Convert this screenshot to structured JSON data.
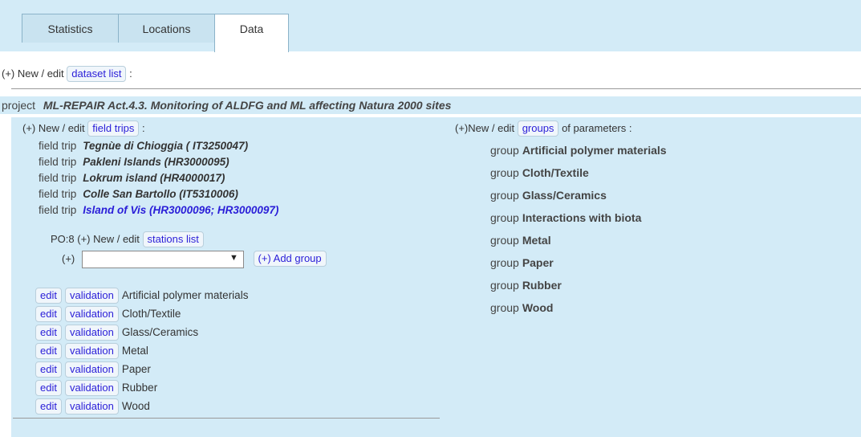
{
  "tabs": [
    {
      "label": "Statistics"
    },
    {
      "label": "Locations"
    },
    {
      "label": "Data"
    }
  ],
  "datasets": {
    "prefix": "(+) New / edit",
    "button": "dataset list",
    "suffix": ":"
  },
  "project": {
    "label": "project",
    "name": "ML-REPAIR Act.4.3. Monitoring of ALDFG and ML affecting Natura 2000 sites"
  },
  "field_trips": {
    "prefix": "(+) New / edit",
    "button": "field trips",
    "suffix": ":",
    "item_label": "field trip",
    "items": [
      {
        "name": "Tegnùe di Chioggia ( IT3250047)"
      },
      {
        "name": "Pakleni Islands (HR3000095)"
      },
      {
        "name": "Lokrum island (HR4000017)"
      },
      {
        "name": "Colle San Bartollo (IT5310006)"
      },
      {
        "name": "Island of Vis (HR3000096; HR3000097)"
      }
    ]
  },
  "stations": {
    "prefix": "PO:8 (+) New / edit",
    "button": "stations list"
  },
  "add_group": {
    "prefix": "(+)",
    "selected": "",
    "button": "(+) Add group"
  },
  "group_rows": {
    "edit_label": "edit",
    "validation_label": "validation",
    "items": [
      {
        "name": "Artificial polymer materials"
      },
      {
        "name": "Cloth/Textile"
      },
      {
        "name": "Glass/Ceramics"
      },
      {
        "name": "Metal"
      },
      {
        "name": "Paper"
      },
      {
        "name": "Rubber"
      },
      {
        "name": "Wood"
      }
    ]
  },
  "groups": {
    "prefix": "(+)New / edit",
    "button": "groups",
    "suffix": "of parameters :",
    "item_label": "group",
    "items": [
      {
        "name": "Artificial polymer materials"
      },
      {
        "name": "Cloth/Textile"
      },
      {
        "name": "Glass/Ceramics"
      },
      {
        "name": "Interactions with biota"
      },
      {
        "name": "Metal"
      },
      {
        "name": "Paper"
      },
      {
        "name": "Rubber"
      },
      {
        "name": "Wood"
      }
    ]
  },
  "colors": {
    "panel": "#d3ebf7",
    "link": "#2a1ed8"
  }
}
